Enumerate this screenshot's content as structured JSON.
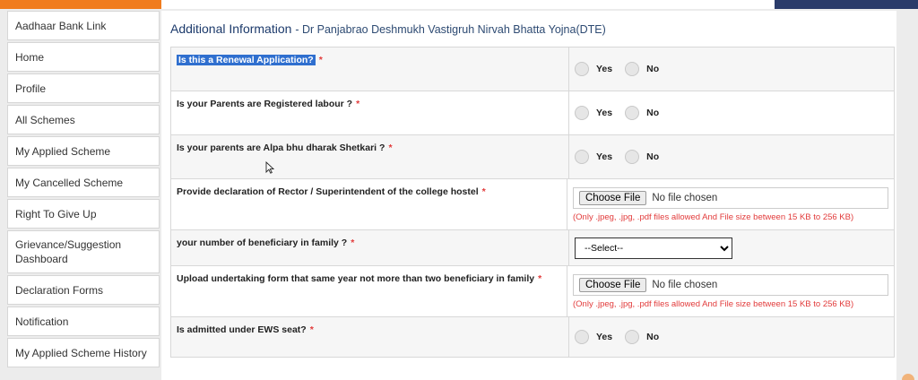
{
  "sidebar": {
    "items": [
      "Aadhaar Bank Link",
      "Home",
      "Profile",
      "All Schemes",
      "My Applied Scheme",
      "My Cancelled Scheme",
      "Right To Give Up",
      "Grievance/Suggestion Dashboard",
      "Declaration Forms",
      "Notification",
      "My Applied Scheme History"
    ]
  },
  "main": {
    "heading": "Additional Information",
    "scheme_name": "- Dr Panjabrao Deshmukh Vastigruh Nirvah Bhatta Yojna(DTE)"
  },
  "form": {
    "required_mark": "*",
    "radio_yes": "Yes",
    "radio_no": "No",
    "choose_file": "Choose File",
    "no_file": "No file chosen",
    "file_hint": "(Only .jpeg, .jpg, .pdf files allowed And File size between 15 KB to 256 KB)",
    "select_placeholder": "--Select--",
    "questions": {
      "renewal": "Is this a Renewal Application?",
      "parents_labour": "Is your Parents are Registered labour ?",
      "alpa_bhu": "Is your parents are Alpa bhu dharak Shetkari ?",
      "rector_declaration": "Provide declaration of Rector / Superintendent of the college hostel",
      "beneficiary_count": "your number of beneficiary in family ?",
      "undertaking": "Upload undertaking form that same year not more than two beneficiary in family",
      "ews": "Is admitted under EWS seat?"
    }
  },
  "colors": {
    "heading": "#1c3a6b",
    "required": "#e23b3b",
    "highlight": "#2f6fcf",
    "top_orange": "#f07c1e",
    "top_navy": "#2a3b6a"
  }
}
